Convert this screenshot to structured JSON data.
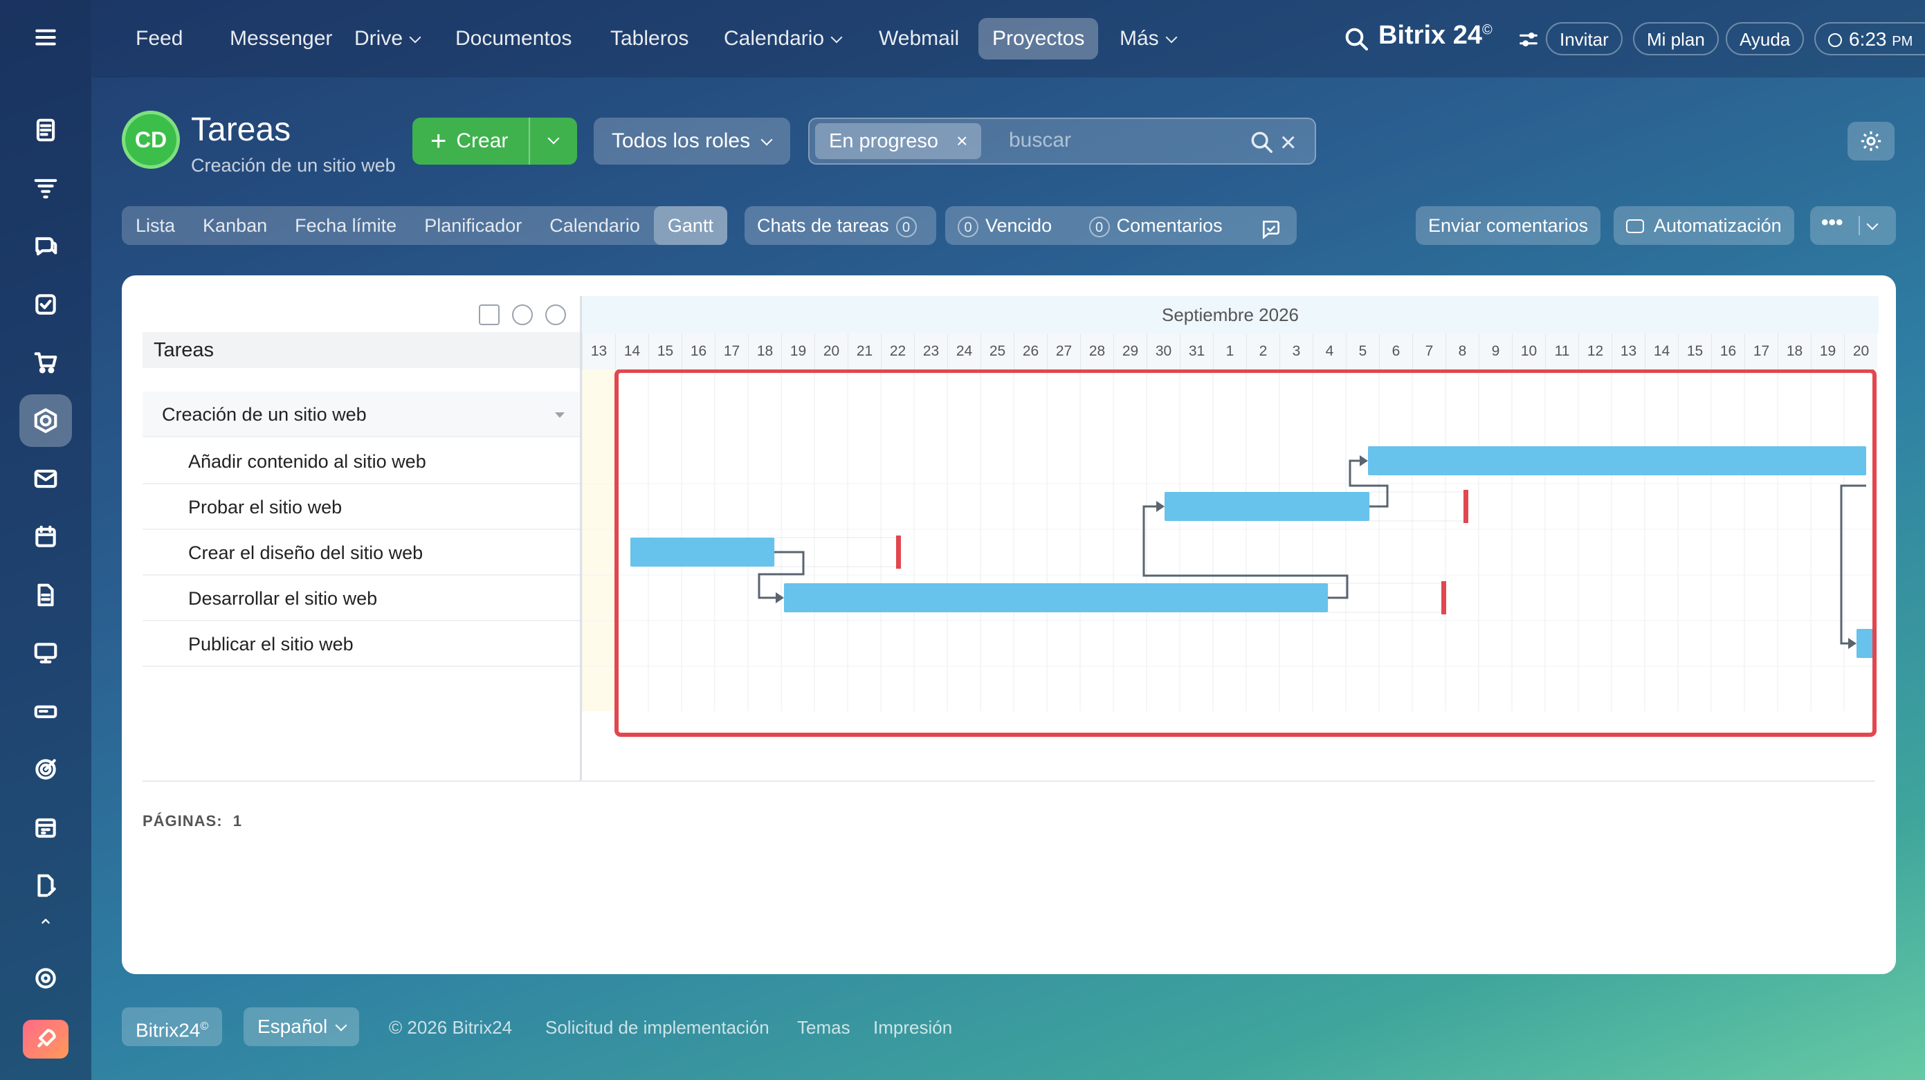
{
  "nav": {
    "items": [
      "Feed",
      "Messenger",
      "Drive",
      "Documentos",
      "Tableros",
      "Calendario",
      "Webmail",
      "Proyectos",
      "Más"
    ],
    "active": "Proyectos",
    "brand": "Bitrix 24",
    "brand_mark": "©",
    "invite": "Invitar",
    "plan": "Mi plan",
    "help": "Ayuda",
    "time": "6:23",
    "time_suffix": "PM"
  },
  "header": {
    "badge": "CD",
    "title": "Tareas",
    "subtitle": "Creación de un sitio web",
    "create_label": "Crear",
    "roles_label": "Todos los roles",
    "filter_chip": "En progreso",
    "search_placeholder": "buscar"
  },
  "views": {
    "tabs": [
      "Lista",
      "Kanban",
      "Fecha límite",
      "Planificador",
      "Calendario",
      "Gantt"
    ],
    "active": "Gantt",
    "chats_label": "Chats de tareas",
    "chats_count": "0",
    "overdue_count": "0",
    "overdue_label": "Vencido",
    "comments_count": "0",
    "comments_label": "Comentarios",
    "feedback_label": "Enviar comentarios",
    "automation_label": "Automatización"
  },
  "gantt": {
    "tasks_header": "Tareas",
    "group": "Creación de un sitio web",
    "tasks": [
      "Añadir contenido al sitio web",
      "Probar el sitio web",
      "Crear el diseño del sitio web",
      "Desarrollar el sitio web",
      "Publicar el sitio web"
    ],
    "month": "Septiembre 2026",
    "days": [
      "13",
      "14",
      "15",
      "16",
      "17",
      "18",
      "19",
      "20",
      "21",
      "22",
      "23",
      "24",
      "25",
      "26",
      "27",
      "28",
      "29",
      "30",
      "31",
      "1",
      "2",
      "3",
      "4",
      "5",
      "6",
      "7",
      "8",
      "9",
      "10",
      "11",
      "12",
      "13",
      "14",
      "15",
      "16",
      "17",
      "18",
      "19",
      "20"
    ],
    "highlight_color": "#e2474f",
    "bar_color": "#67c2ec",
    "deadline_color": "#e2474f",
    "pages_label": "PÁGINAS:",
    "pages_value": "1"
  },
  "footer": {
    "brand": "Bitrix24",
    "language": "Español",
    "copyright": "© 2026 Bitrix24",
    "links": [
      "Solicitud de implementación",
      "Temas",
      "Impresión"
    ]
  }
}
